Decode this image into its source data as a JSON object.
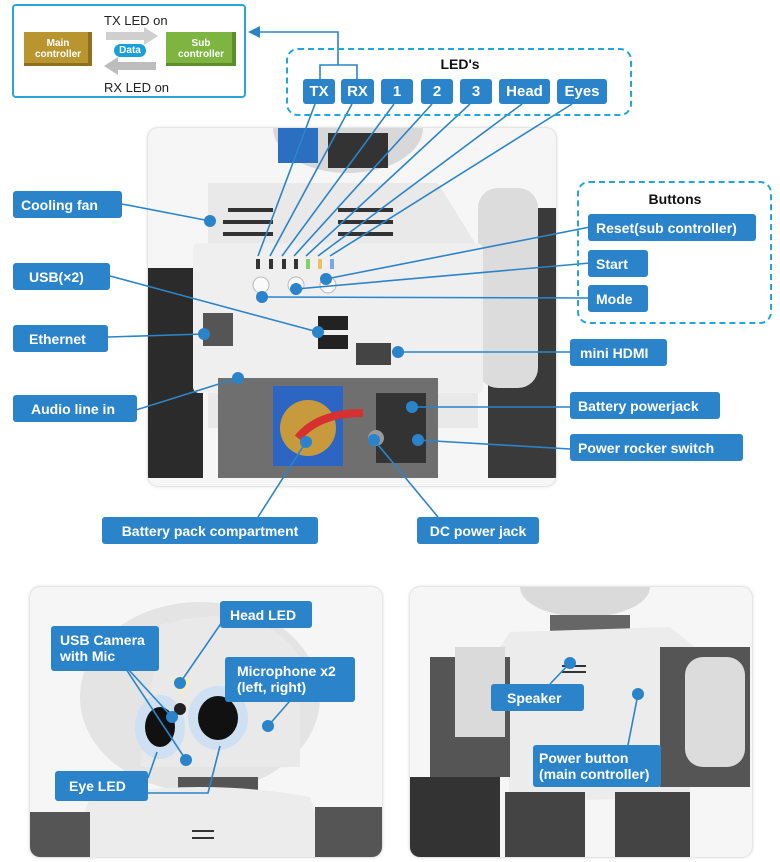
{
  "data_flow": {
    "tx_text": "TX LED on",
    "rx_text": "RX LED on",
    "main_controller": "Main\ncontroller",
    "sub_controller": "Sub\ncontroller",
    "data_badge": "Data",
    "colors": {
      "main": "#b99530",
      "sub": "#7db540",
      "badge": "#1aa0d8",
      "frame": "#2ba5d8"
    }
  },
  "leds": {
    "title": "LED's",
    "items": [
      "TX",
      "RX",
      "1",
      "2",
      "3",
      "Head",
      "Eyes"
    ]
  },
  "buttons_group": {
    "title": "Buttons",
    "items": [
      "Reset(sub controller)",
      "Start",
      "Mode"
    ]
  },
  "back_panel": {
    "left_labels": [
      "Cooling fan",
      "USB(×2)",
      "Ethernet",
      "Audio line in"
    ],
    "right_labels": [
      "mini HDMI",
      "Battery powerjack",
      "Power rocker switch"
    ],
    "bottom_labels": [
      "Battery pack compartment",
      "DC power jack"
    ]
  },
  "head_panel": {
    "labels": [
      "Head LED",
      "USB Camera\nwith Mic",
      "Microphone x2\n(left, right)",
      "Eye LED"
    ]
  },
  "torso_panel": {
    "labels": [
      "Speaker",
      "Power button\n(main controller)"
    ]
  },
  "colors": {
    "label_bg": "#2b84c9",
    "line": "#2b84c9",
    "dash": "#22a6d8"
  }
}
